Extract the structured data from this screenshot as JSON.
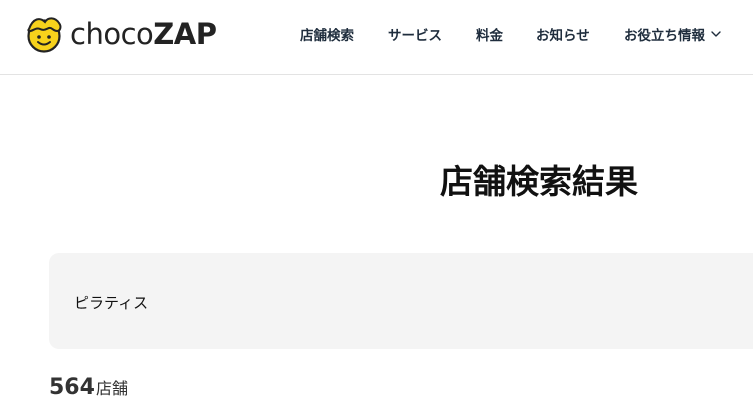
{
  "header": {
    "logo": {
      "text_light": "choco",
      "text_bold": "ZAP",
      "icon": "chocozap-mascot-icon"
    },
    "nav": [
      {
        "label": "店舗検索"
      },
      {
        "label": "サービス"
      },
      {
        "label": "料金"
      },
      {
        "label": "お知らせ"
      },
      {
        "label": "お役立ち情報",
        "icon": "chevron-down-icon"
      }
    ]
  },
  "main": {
    "page_title": "店舗検索結果",
    "search_term": "ピラティス",
    "result_count": "564",
    "result_unit": "店舗"
  },
  "colors": {
    "logo_yellow": "#f7d21c",
    "nav_text": "#1f2d3d",
    "search_box_bg": "#f4f4f4",
    "header_border": "#e3e3e3"
  }
}
